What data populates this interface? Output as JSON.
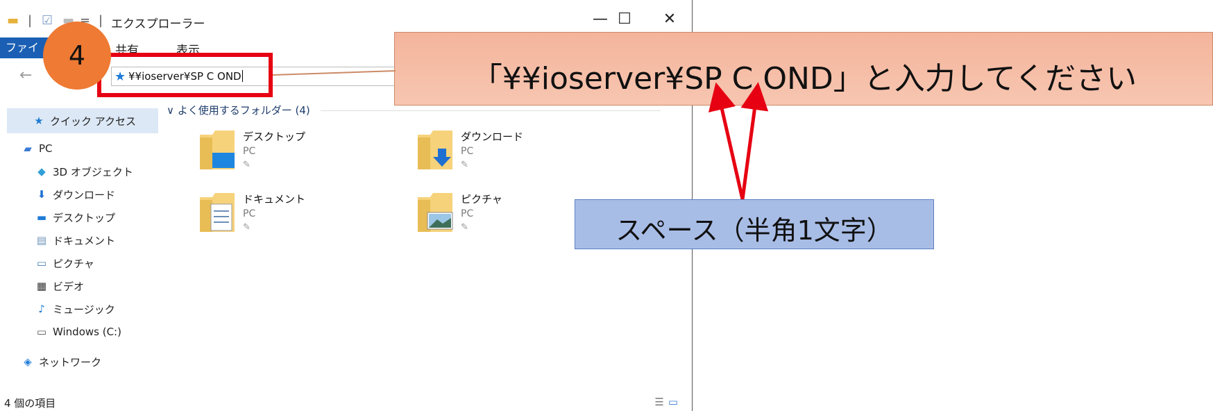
{
  "window": {
    "title": "エクスプローラー",
    "controls": {
      "minimize": "—",
      "maximize": "☐",
      "close": "✕"
    }
  },
  "ribbon": {
    "file_tab": "ファイ",
    "tabs": [
      "共有",
      "表示"
    ]
  },
  "address": {
    "value": "¥¥ioserver¥SP C OND",
    "icon": "star-icon"
  },
  "nav": {
    "quick_access": "クイック アクセス",
    "items": [
      {
        "label": "PC",
        "icon": "pc-icon",
        "color": "#3a7bd5"
      },
      {
        "label": "3D オブジェクト",
        "icon": "cube-icon",
        "color": "#2f9fd6"
      },
      {
        "label": "ダウンロード",
        "icon": "download-arrow-icon",
        "color": "#1f6fd1"
      },
      {
        "label": "デスクトップ",
        "icon": "desktop-icon",
        "color": "#1f7bd6"
      },
      {
        "label": "ドキュメント",
        "icon": "document-icon",
        "color": "#6b8fb8"
      },
      {
        "label": "ピクチャ",
        "icon": "picture-icon",
        "color": "#4a7fb0"
      },
      {
        "label": "ビデオ",
        "icon": "video-icon",
        "color": "#333333"
      },
      {
        "label": "ミュージック",
        "icon": "music-icon",
        "color": "#1f7bd6"
      },
      {
        "label": "Windows (C:)",
        "icon": "drive-icon",
        "color": "#555555"
      },
      {
        "label": "ネットワーク",
        "icon": "network-icon",
        "color": "#1f7bd6"
      }
    ]
  },
  "content": {
    "group_header": "よく使用するフォルダー (4)",
    "folders": [
      {
        "name": "デスクトップ",
        "location": "PC"
      },
      {
        "name": "ダウンロード",
        "location": "PC"
      },
      {
        "name": "ドキュメント",
        "location": "PC"
      },
      {
        "name": "ピクチャ",
        "location": "PC"
      }
    ]
  },
  "status": {
    "item_count": "4 個の項目"
  },
  "annotations": {
    "step_number": "4",
    "instruction": "「¥¥ioserver¥SP C OND」と入力してください",
    "space_note": "スペース（半角1文字）",
    "colors": {
      "step": "#ee7a33",
      "frame": "#e60012",
      "callout": "#f4b49b",
      "note": "#a8bde6"
    }
  }
}
